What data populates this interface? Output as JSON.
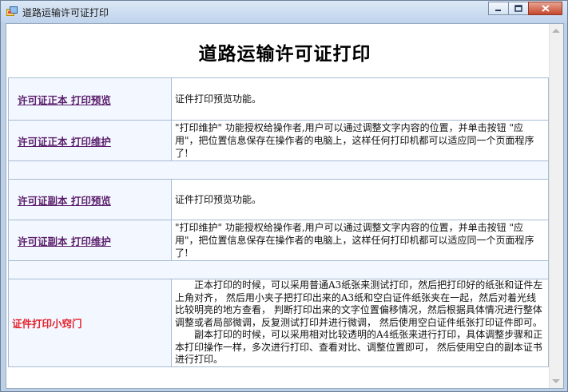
{
  "window": {
    "title": "道路运输许可证打印"
  },
  "main": {
    "page_title": "道路运输许可证打印",
    "rows": [
      {
        "link": "许可证正本  打印预览",
        "desc": "证件打印预览功能。"
      },
      {
        "link": "许可证正本  打印维护",
        "desc": "\"打印维护\" 功能授权给操作者,用户可以通过调整文字内容的位置，并单击按钮 \"应用\"，把位置信息保存在操作者的电脑上，这样任何打印机都可以适应同一个页面程序了!"
      },
      {
        "link": "许可证副本  打印预览",
        "desc": "证件打印预览功能。"
      },
      {
        "link": "许可证副本  打印维护",
        "desc": "\"打印维护\" 功能授权给操作者,用户可以通过调整文字内容的位置，并单击按钮 \"应用\"，把位置信息保存在操作者的电脑上，这样任何打印机都可以适应同一个页面程序了!"
      }
    ],
    "tips": {
      "label": "证件打印小窍门",
      "para1": "正本打印的时候，可以采用普通A3纸张来测试打印，然后把打印好的纸张和证件左上角对齐，  然后用小夹子把打印出来的A3纸和空白证件纸张夹在一起，然后对着光线比较明亮的地方查看，  判断打印出来的文字位置偏移情况，然后根据具体情况进行整体调整或者局部微调，反复测试打印并进行微调，  然后使用空白证件纸张打印证件即可。",
      "para2": "副本打印的时候，可以采用相对比较透明的A4纸张来进行打印，具体调整步骤和正本打印操作一样，多次进行打印、查看对比、调整位置即可，  然后使用空白的副本证书进行打印。"
    }
  },
  "icons": {
    "app": "app-window-icon",
    "minimize": "minimize-icon",
    "maximize": "maximize-icon",
    "close": "close-icon"
  },
  "colors": {
    "link": "#5b1f6b",
    "tips_label": "#e4212b",
    "label_cell_bg": "#f3f7ff",
    "grid_border": "#a6bcd3"
  }
}
